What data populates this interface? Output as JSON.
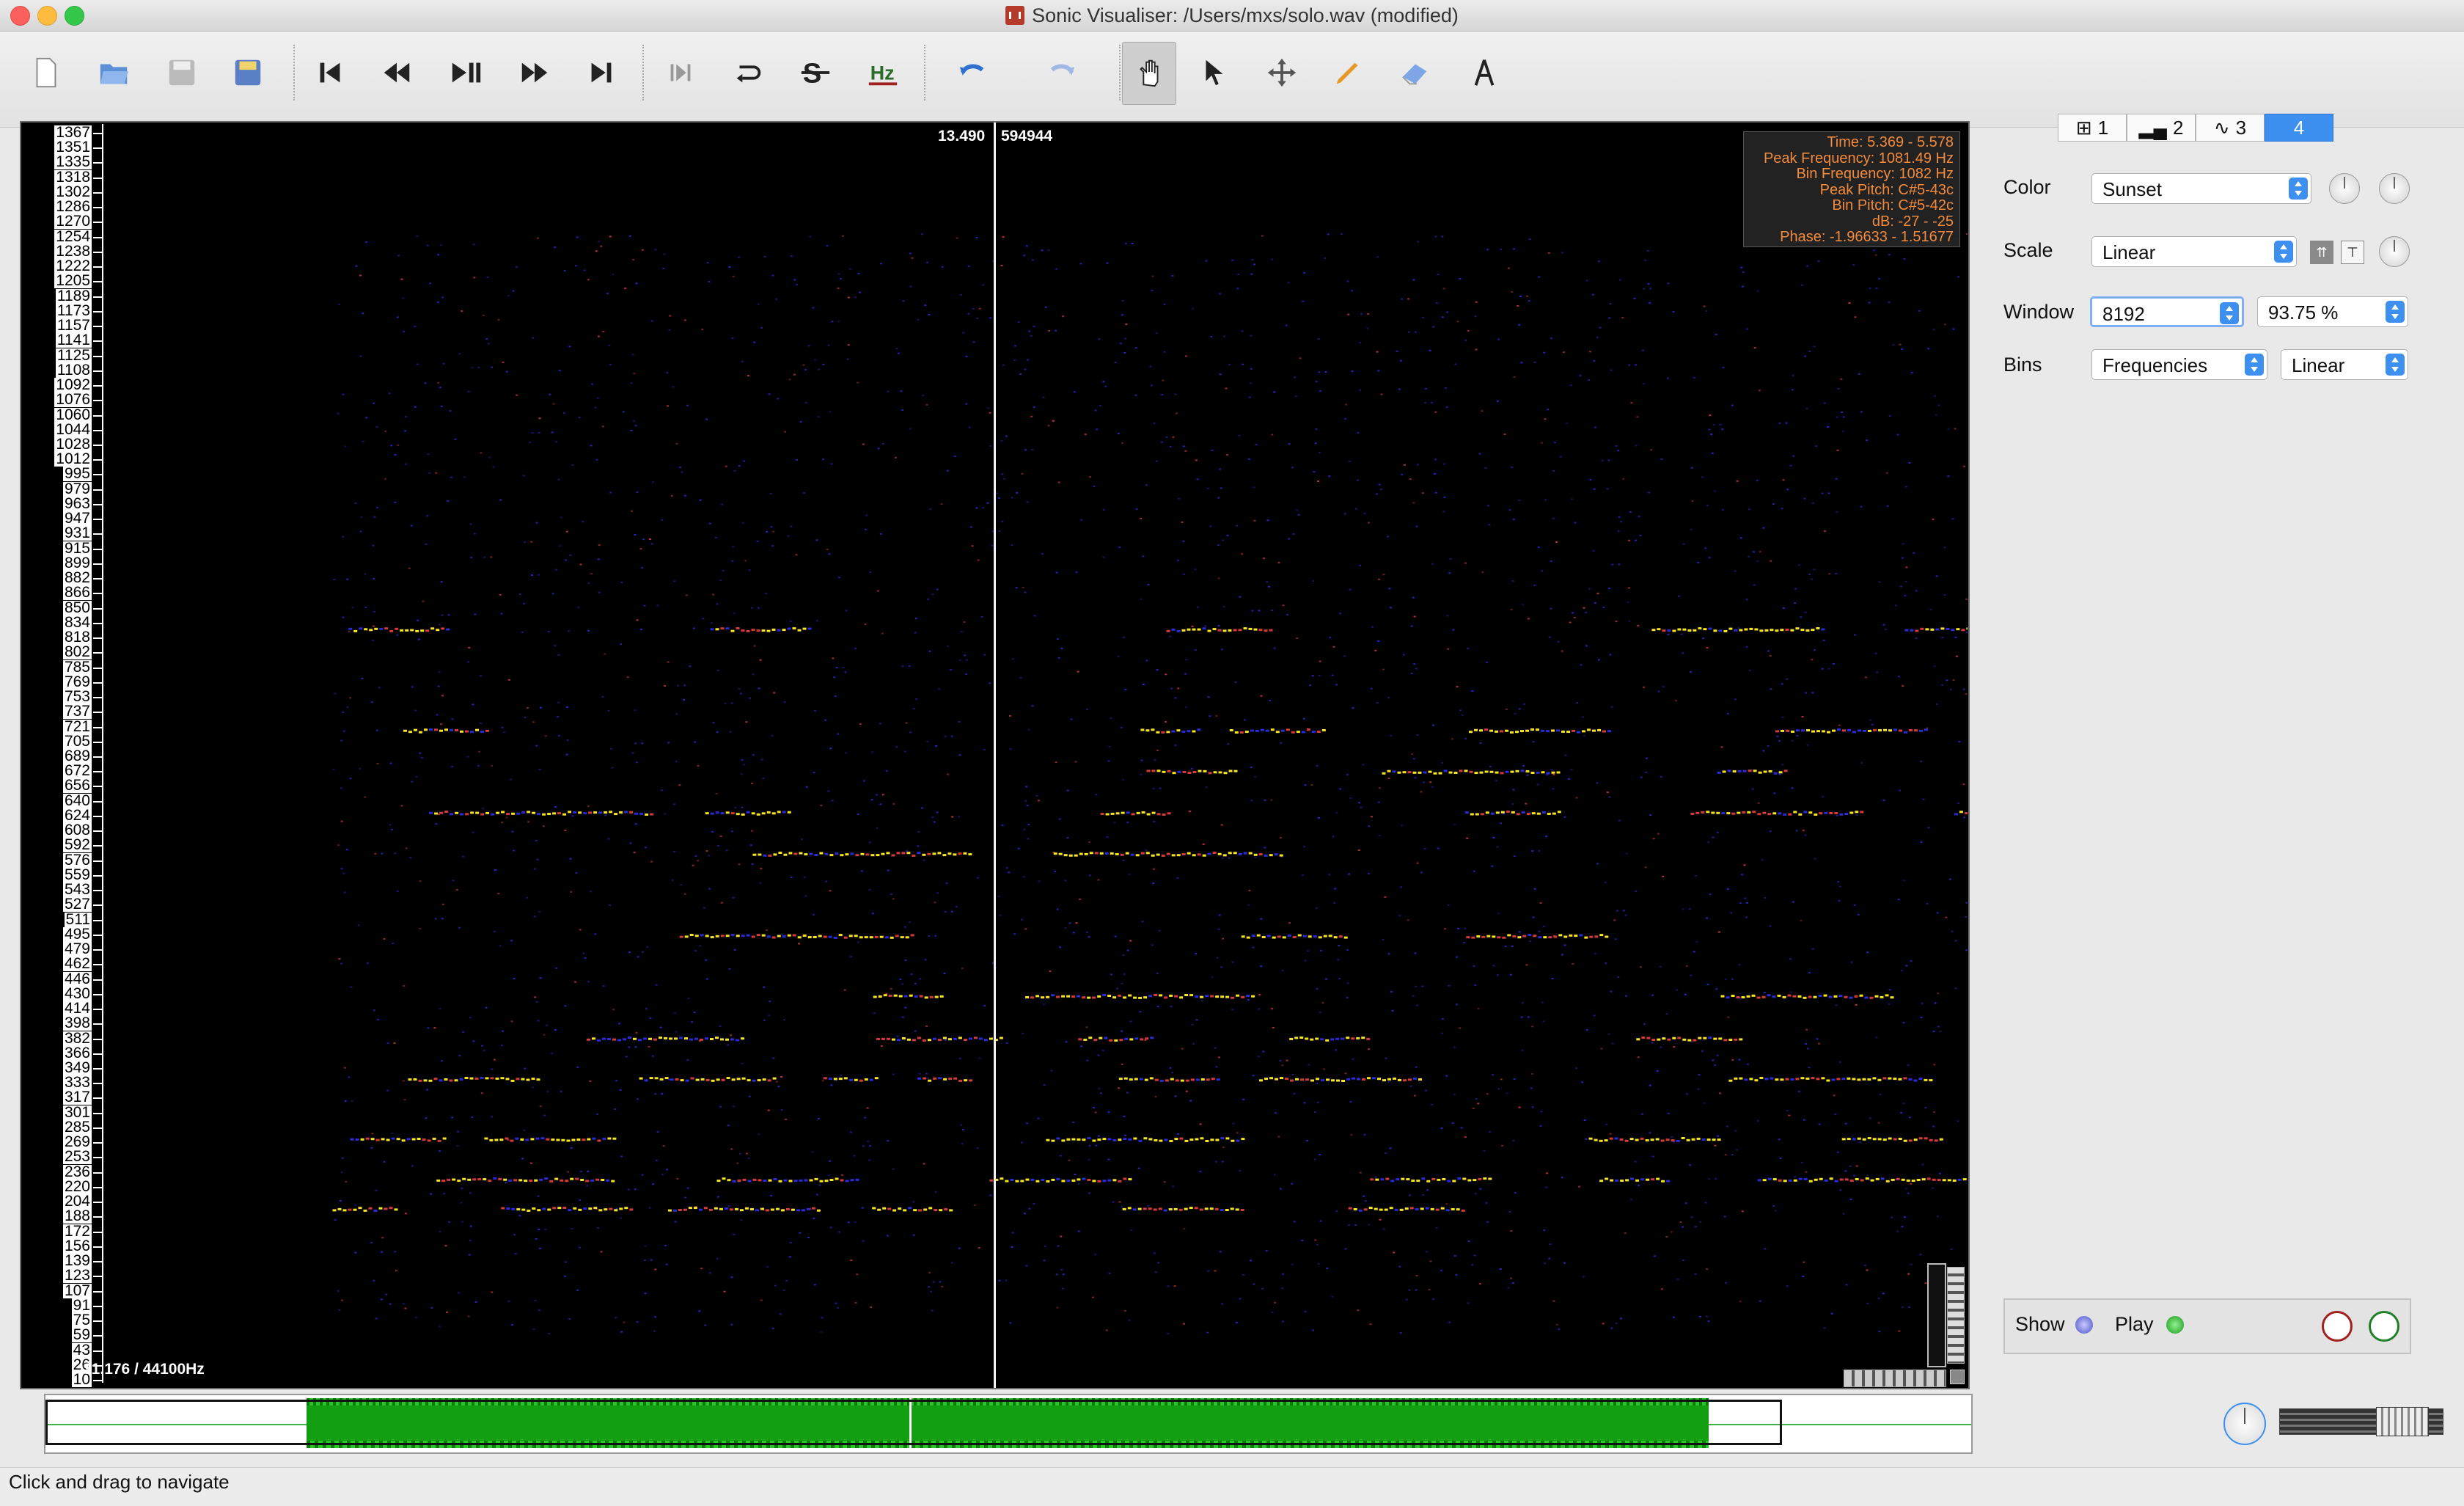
{
  "window": {
    "title": "Sonic Visualiser: /Users/mxs/solo.wav (modified)"
  },
  "toolbar": {
    "tools": [
      "new-file-icon",
      "open-file-icon",
      "save-file-icon",
      "save-session-icon",
      "rewind-start-icon",
      "rewind-icon",
      "play-pause-icon",
      "fast-forward-icon",
      "ffwd-end-icon",
      "play-selection-icon",
      "loop-icon",
      "solo-icon",
      "playback-speed-icon",
      "undo-icon",
      "redo-icon",
      "navigate-hand-icon",
      "select-icon",
      "move-icon",
      "draw-icon",
      "erase-icon",
      "measure-icon"
    ],
    "active_tool": "navigate-hand-icon"
  },
  "view": {
    "time_cursor": "13.490",
    "frame_cursor": "594944",
    "bottom_info": "31.176 / 44100Hz",
    "freq_ticks": [
      "1367",
      "1351",
      "1335",
      "1318",
      "1302",
      "1286",
      "1270",
      "1254",
      "1238",
      "1222",
      "1205",
      "1189",
      "1173",
      "1157",
      "1141",
      "1125",
      "1108",
      "1092",
      "1076",
      "1060",
      "1044",
      "1028",
      "1012",
      "995",
      "979",
      "963",
      "947",
      "931",
      "915",
      "899",
      "882",
      "866",
      "850",
      "834",
      "818",
      "802",
      "785",
      "769",
      "753",
      "737",
      "721",
      "705",
      "689",
      "672",
      "656",
      "640",
      "624",
      "608",
      "592",
      "576",
      "559",
      "543",
      "527",
      "511",
      "495",
      "479",
      "462",
      "446",
      "430",
      "414",
      "398",
      "382",
      "366",
      "349",
      "333",
      "317",
      "301",
      "285",
      "269",
      "253",
      "236",
      "220",
      "204",
      "188",
      "172",
      "156",
      "139",
      "123",
      "107",
      "91",
      "75",
      "59",
      "43",
      "26",
      "10"
    ],
    "info": [
      "Time: 5.369 - 5.578",
      "Peak Frequency: 1081.49 Hz",
      "Bin Frequency: 1082 Hz",
      "Peak Pitch: C#5-43c",
      "Bin Pitch: C#5-42c",
      "dB: -27 - -25",
      "Phase: -1.96633 - 1.51677"
    ]
  },
  "pane_tabs": [
    {
      "num": "1",
      "icon": "ruler-icon"
    },
    {
      "num": "2",
      "icon": "bars-icon"
    },
    {
      "num": "3",
      "icon": "waveform-icon"
    },
    {
      "num": "4",
      "icon": ""
    }
  ],
  "properties": {
    "color_label": "Color",
    "color_value": "Sunset",
    "scale_label": "Scale",
    "scale_value": "Linear",
    "window_label": "Window",
    "window_value": "8192",
    "overlap_value": "93.75 %",
    "bins_label": "Bins",
    "bins_value": "Frequencies",
    "bins_scale_value": "Linear"
  },
  "layer": {
    "show_label": "Show",
    "play_label": "Play"
  },
  "status": {
    "text": "Click and drag to navigate"
  },
  "colors": {
    "accent": "#3d8ff0",
    "note_yellow": "#f7e425",
    "note_red": "#d43a3a",
    "note_blue": "#2a2ad8",
    "overview_green": "#12a012"
  }
}
